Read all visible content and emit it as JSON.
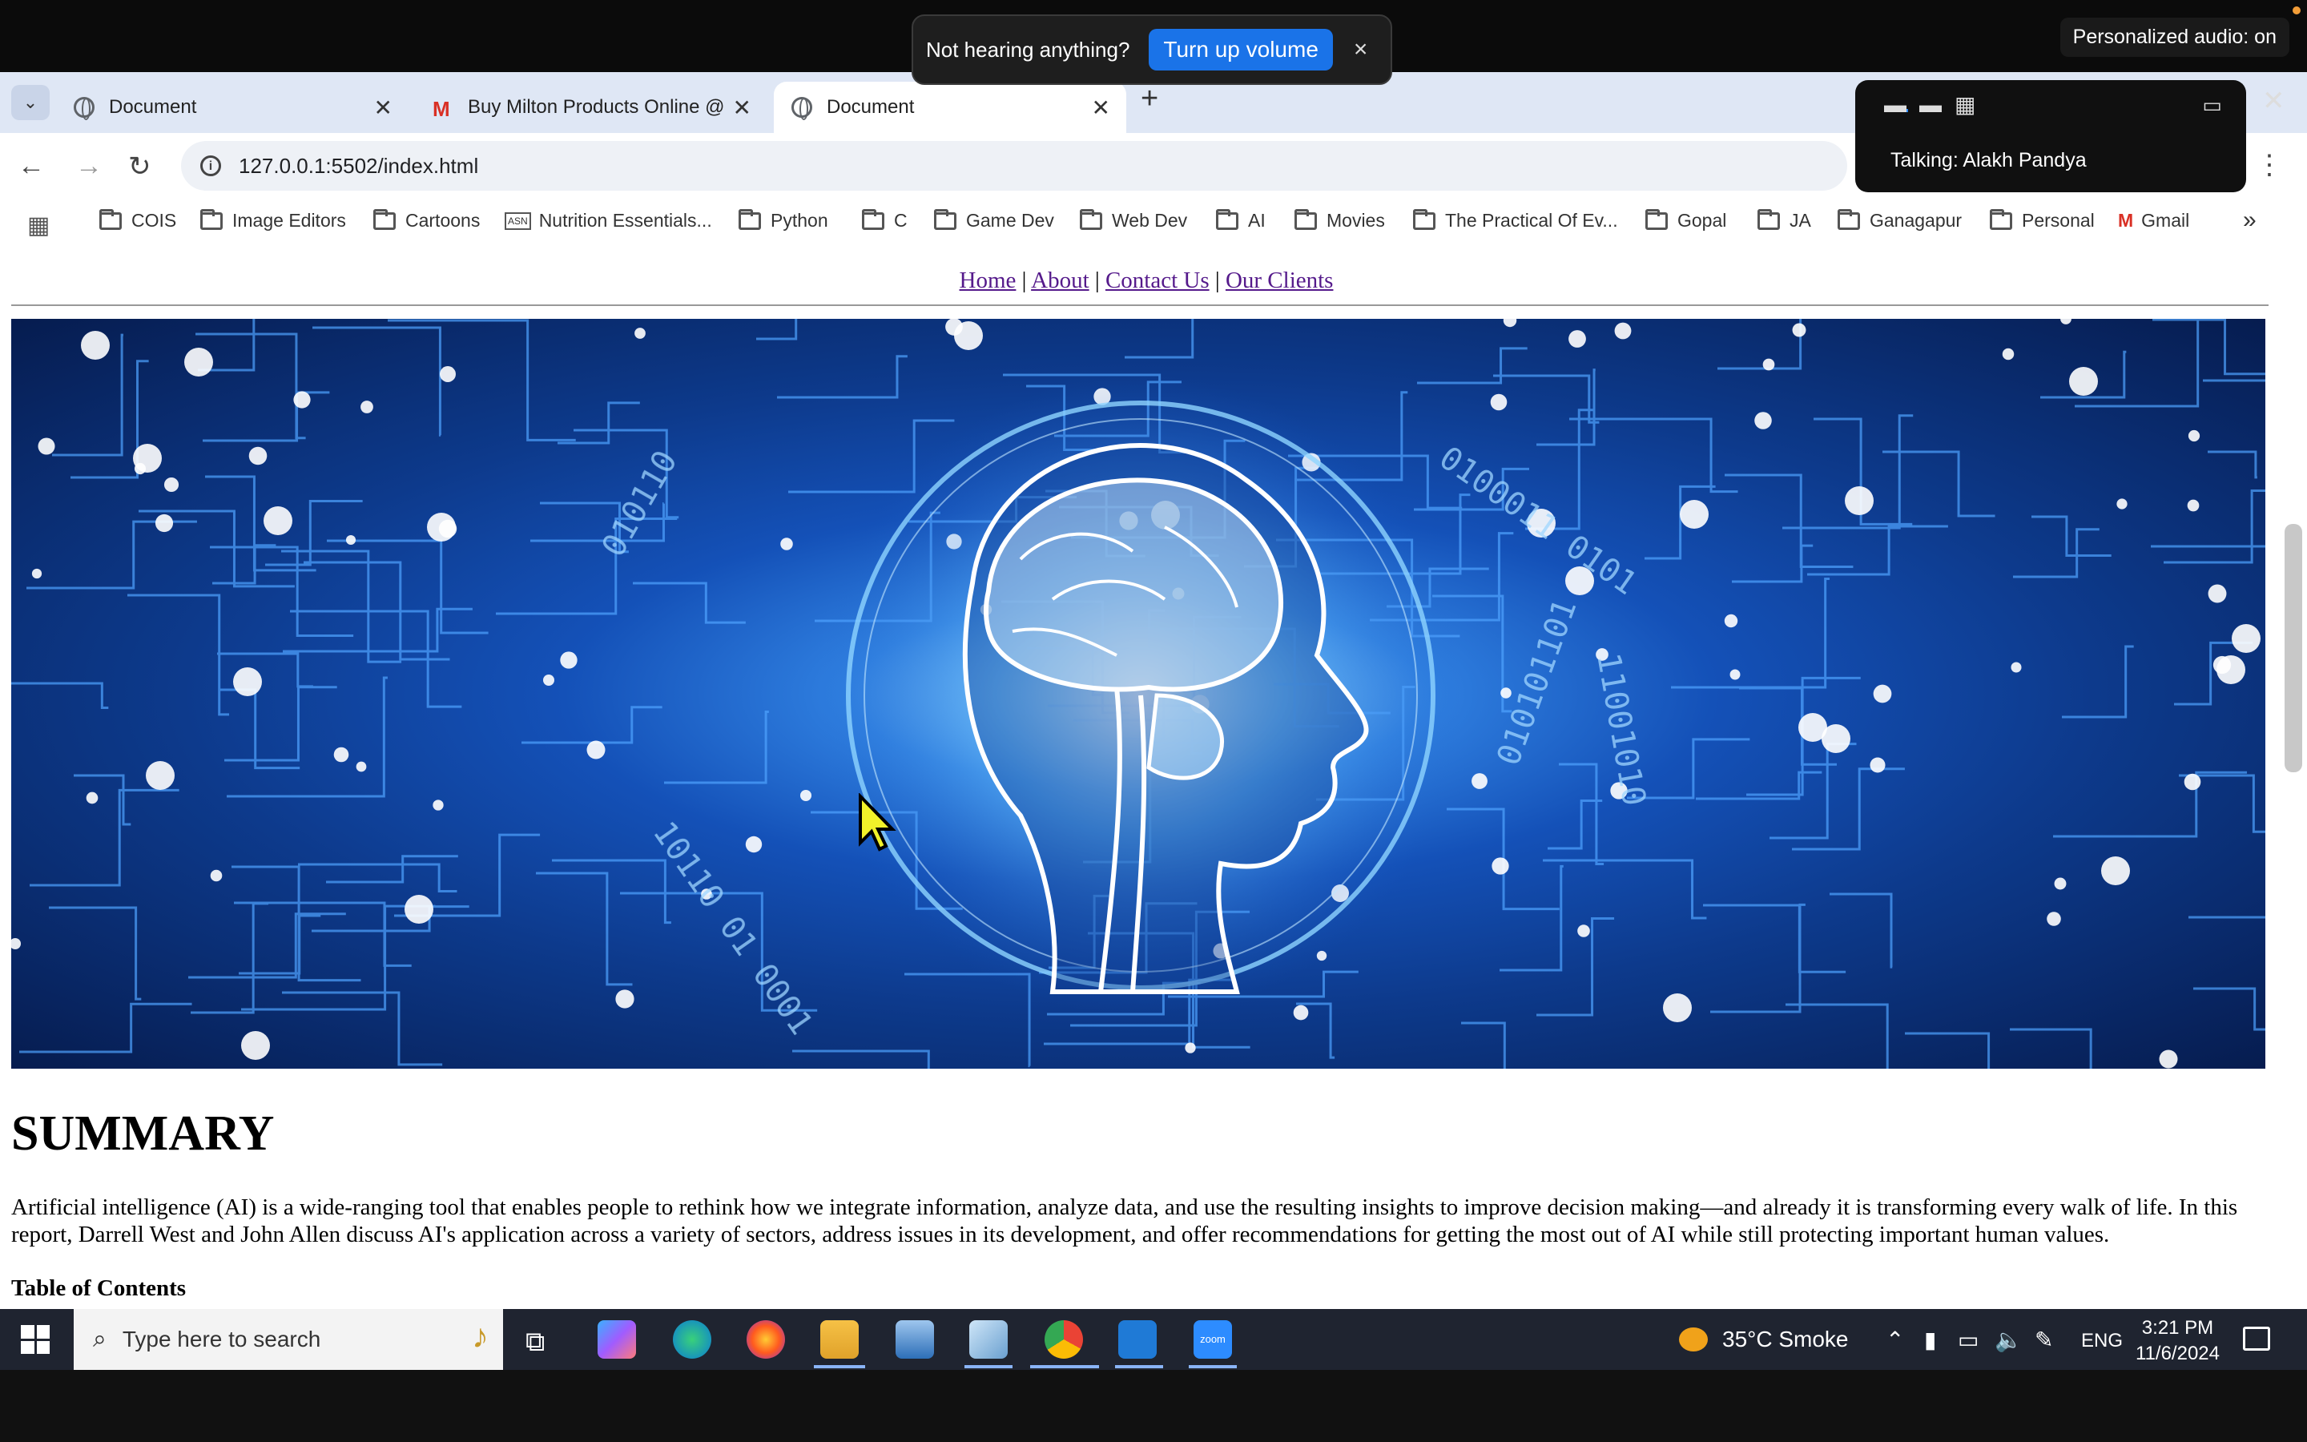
{
  "overlay": {
    "volume_message": "Not hearing anything?",
    "volume_button": "Turn up volume",
    "volume_close": "×",
    "personalized_audio": "Personalized audio: on"
  },
  "zoom": {
    "talking": "Talking: Alakh Pandya",
    "close": "✕"
  },
  "tabs": [
    {
      "title": "Document",
      "close": "✕"
    },
    {
      "title": "Buy Milton Products Online @",
      "close": "✕"
    },
    {
      "title": "Document",
      "close": "✕"
    }
  ],
  "browser": {
    "url": "127.0.0.1:5502/index.html",
    "new_tab": "+",
    "tab_dropdown": "⌄"
  },
  "bookmarks": [
    "COIS",
    "Image Editors",
    "Cartoons",
    "Nutrition Essentials...",
    "Python",
    "C",
    "Game Dev",
    "Web Dev",
    "AI",
    "Movies",
    "The Practical Of Ev...",
    "Gopal",
    "JA",
    "Ganagapur",
    "Personal",
    "Gmail"
  ],
  "bookmarks_more": "»",
  "site": {
    "nav": [
      "Home",
      "About",
      "Contact Us",
      "Our Clients"
    ],
    "nav_separator": "|",
    "summary_title": "SUMMARY",
    "summary_text": "Artificial intelligence (AI) is a wide-ranging tool that enables people to rethink how we integrate information, analyze data, and use the resulting insights to improve decision making—and already it is transforming every walk of life. In this report, Darrell West and John Allen discuss AI's application across a variety of sectors, address issues in its development, and offer recommendations for getting the most out of AI while still protecting important human values.",
    "toc_title": "Table of Contents"
  },
  "taskbar": {
    "search_placeholder": "Type here to search",
    "weather": "35°C  Smoke",
    "language": "ENG",
    "time": "3:21 PM",
    "date": "11/6/2024",
    "zoom_app_label": "zoom"
  },
  "colors": {
    "tabstrip": "#dfe7f5",
    "link_visited": "#551a8b",
    "accent_blue": "#1a73e8",
    "taskbar": "#1f2430"
  }
}
